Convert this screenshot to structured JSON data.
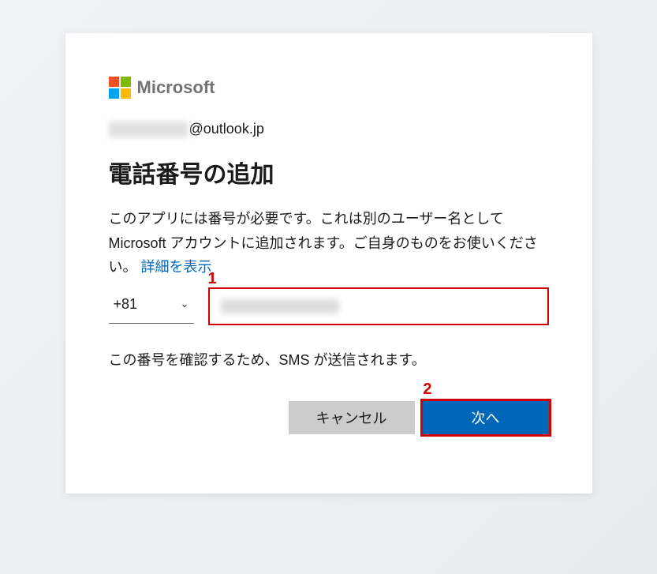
{
  "brand": {
    "name": "Microsoft"
  },
  "account": {
    "domain": "@outlook.jp"
  },
  "title": "電話番号の追加",
  "description_part1": "このアプリには番号が必要です。これは別のユーザー名として Microsoft アカウントに追加されます。ご自身のものをお使いください。 ",
  "details_link": "詳細を表示",
  "phone": {
    "country_code": "+81"
  },
  "sms_note": "この番号を確認するため、SMS が送信されます。",
  "buttons": {
    "cancel": "キャンセル",
    "next": "次へ"
  },
  "annotations": {
    "one": "1",
    "two": "2"
  }
}
